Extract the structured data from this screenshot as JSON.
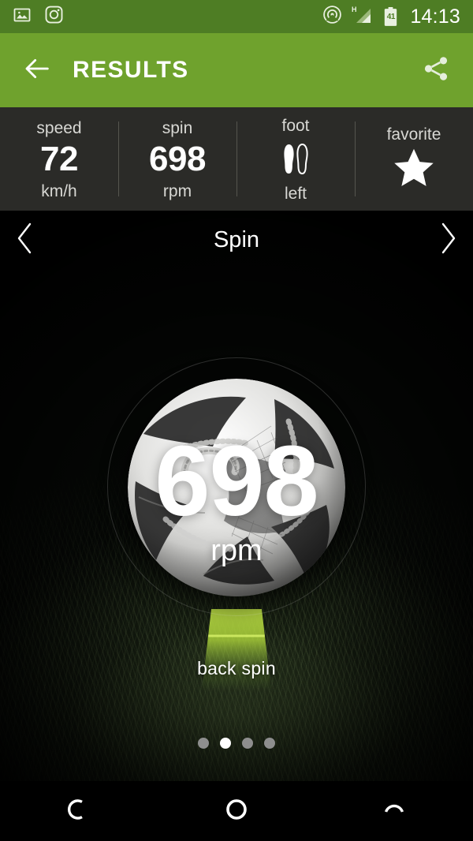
{
  "statusbar": {
    "time": "14:13",
    "battery_level": "41",
    "icons": [
      {
        "name": "gallery-icon"
      },
      {
        "name": "instagram-icon"
      },
      {
        "name": "cast-icon"
      },
      {
        "name": "signal-h-icon",
        "label": "H"
      },
      {
        "name": "battery-icon"
      }
    ],
    "background": "#4e7d24"
  },
  "appbar": {
    "title": "RESULTS",
    "back_icon": "arrow-left-icon",
    "share_icon": "share-icon",
    "background": "#6fa22d"
  },
  "stats": {
    "background": "#2b2b28",
    "items": [
      {
        "label": "speed",
        "value": "72",
        "unit": "km/h",
        "icon": null
      },
      {
        "label": "spin",
        "value": "698",
        "unit": "rpm",
        "icon": null
      },
      {
        "label": "foot",
        "value": null,
        "unit": "left",
        "icon": "footprints-icon"
      },
      {
        "label": "favorite",
        "value": null,
        "unit": "",
        "icon": "star-icon"
      }
    ]
  },
  "carousel": {
    "title": "Spin",
    "prev_icon": "chevron-left-icon",
    "next_icon": "chevron-right-icon",
    "page_count": 4,
    "active_page": 2
  },
  "hero": {
    "rpm_value": "698",
    "rpm_unit": "rpm",
    "spin_type": "back spin",
    "cone_color": "#b4dd39",
    "ball_icon": "soccer-ball-icon"
  },
  "navbar": {
    "buttons": [
      {
        "name": "nav-back-button",
        "icon": "back-arc-icon"
      },
      {
        "name": "nav-home-button",
        "icon": "home-circle-icon"
      },
      {
        "name": "nav-recents-button",
        "icon": "recents-arc-icon"
      }
    ]
  }
}
